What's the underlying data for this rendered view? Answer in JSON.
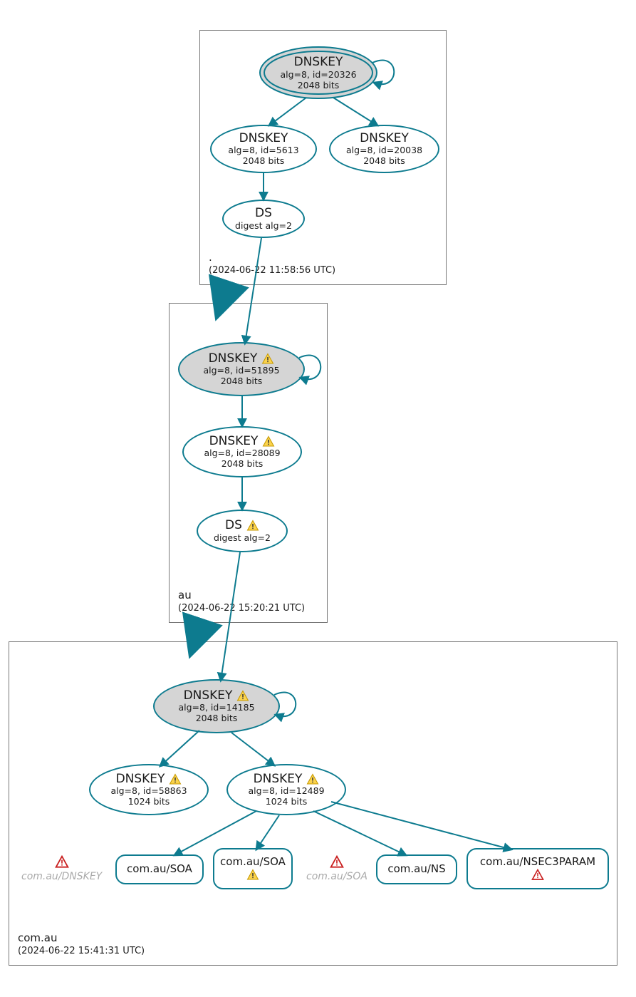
{
  "zones": {
    "root": {
      "name": ".",
      "timestamp": "(2024-06-22 11:58:56 UTC)"
    },
    "au": {
      "name": "au",
      "timestamp": "(2024-06-22 15:20:21 UTC)"
    },
    "comau": {
      "name": "com.au",
      "timestamp": "(2024-06-22 15:41:31 UTC)"
    }
  },
  "nodes": {
    "root_ksk": {
      "title": "DNSKEY",
      "line1": "alg=8, id=20326",
      "line2": "2048 bits",
      "warn": false
    },
    "root_zsk1": {
      "title": "DNSKEY",
      "line1": "alg=8, id=5613",
      "line2": "2048 bits",
      "warn": false
    },
    "root_zsk2": {
      "title": "DNSKEY",
      "line1": "alg=8, id=20038",
      "line2": "2048 bits",
      "warn": false
    },
    "root_ds": {
      "title": "DS",
      "line1": "digest alg=2",
      "line2": "",
      "warn": false
    },
    "au_ksk": {
      "title": "DNSKEY",
      "line1": "alg=8, id=51895",
      "line2": "2048 bits",
      "warn": true
    },
    "au_zsk": {
      "title": "DNSKEY",
      "line1": "alg=8, id=28089",
      "line2": "2048 bits",
      "warn": true
    },
    "au_ds": {
      "title": "DS",
      "line1": "digest alg=2",
      "line2": "",
      "warn": true
    },
    "comau_ksk": {
      "title": "DNSKEY",
      "line1": "alg=8, id=14185",
      "line2": "2048 bits",
      "warn": true
    },
    "comau_zsk1": {
      "title": "DNSKEY",
      "line1": "alg=8, id=58863",
      "line2": "1024 bits",
      "warn": true
    },
    "comau_zsk2": {
      "title": "DNSKEY",
      "line1": "alg=8, id=12489",
      "line2": "1024 bits",
      "warn": true
    }
  },
  "rrsets": {
    "soa1": {
      "label": "com.au/SOA",
      "warn": false,
      "err": false
    },
    "soa2": {
      "label": "com.au/SOA",
      "warn": true,
      "err": false
    },
    "ns": {
      "label": "com.au/NS",
      "warn": false,
      "err": false
    },
    "nsec3": {
      "label": "com.au/NSEC3PARAM",
      "warn": false,
      "err": true
    }
  },
  "ghosts": {
    "dnskey": "com.au/DNSKEY",
    "soa": "com.au/SOA"
  }
}
